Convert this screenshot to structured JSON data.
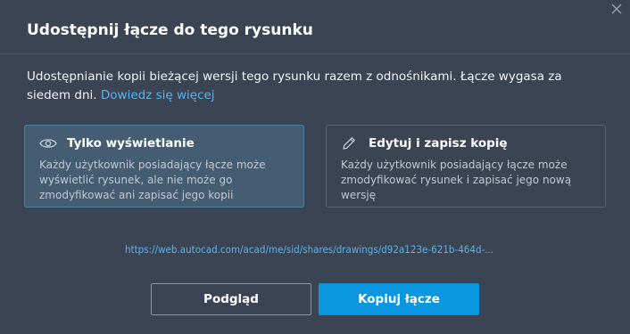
{
  "dialog": {
    "title": "Udostępnij łącze do tego rysunku",
    "description": "Udostępnianie kopii bieżącej wersji tego rysunku razem z odnośnikami. Łącze wygasa za siedem dni. ",
    "learn_more_label": "Dowiedz się więcej",
    "close_icon": "close-icon"
  },
  "options": {
    "view_only": {
      "title": "Tylko wyświetlanie",
      "description": "Każdy użytkownik posiadający łącze może wyświetlić rysunek, ale nie może go zmodyfikować ani zapisać jego kopii",
      "icon": "eye-icon",
      "selected": true
    },
    "edit_save": {
      "title": "Edytuj i zapisz kopię",
      "description": "Każdy użytkownik posiadający łącze może zmodyfikować rysunek i zapisać jego nową wersję",
      "icon": "pencil-icon",
      "selected": false
    }
  },
  "share_link": "https://web.autocad.com/acad/me/sid/shares/drawings/d92a123e-621b-464d-...",
  "buttons": {
    "preview_label": "Podgląd",
    "copy_label": "Kopiuj łącze"
  },
  "colors": {
    "background": "#3b4453",
    "accent": "#0b96e0",
    "link": "#5fb2ea",
    "selected_card": "#445d73"
  }
}
